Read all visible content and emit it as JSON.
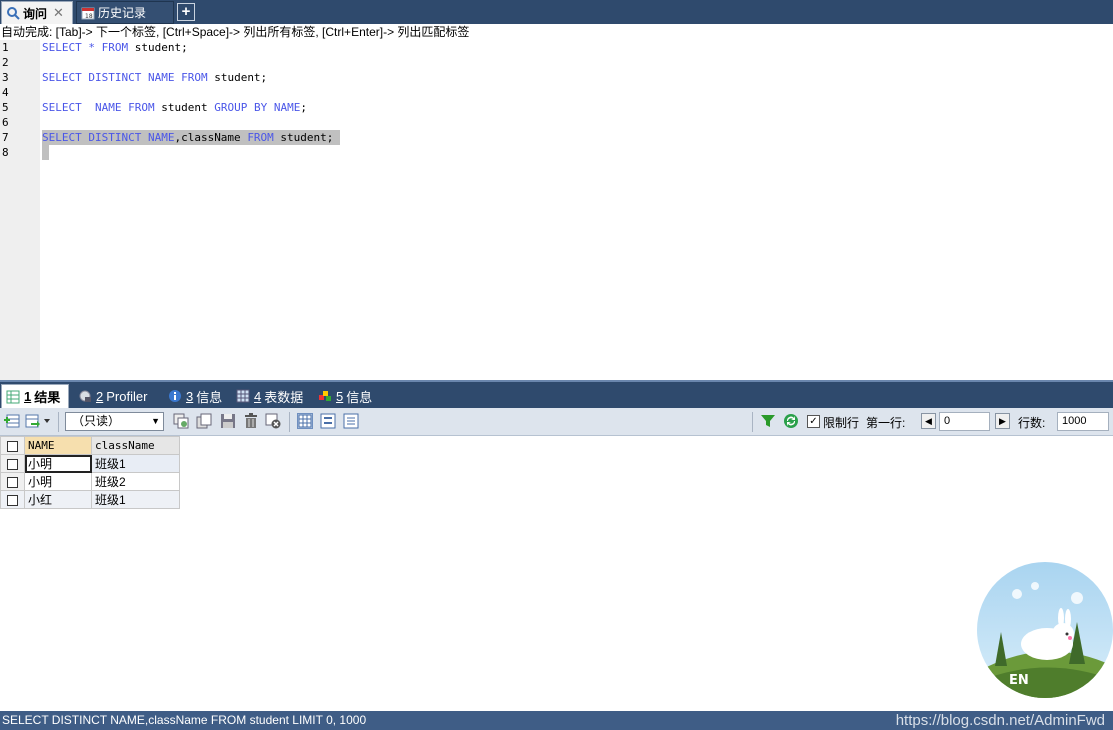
{
  "top_tabs": [
    {
      "label": "询问",
      "close": "✕"
    },
    {
      "label": "历史记录"
    }
  ],
  "add_tab": "+",
  "autocomplete_hint": "自动完成: [Tab]-> 下一个标签, [Ctrl+Space]-> 列出所有标签, [Ctrl+Enter]-> 列出匹配标签",
  "editor": {
    "line_numbers": [
      "1",
      "2",
      "3",
      "4",
      "5",
      "6",
      "7",
      "8"
    ],
    "lines": [
      {
        "kw1": "SELECT",
        "mid": " * ",
        "kw2": "FROM",
        "rest": " student;"
      },
      {
        "kw1": "SELECT DISTINCT NAME",
        "mid": " ",
        "kw2": "FROM",
        "rest": " student;"
      },
      {
        "kw1": "SELECT  NAME",
        "mid": " ",
        "kw2": "FROM",
        "rest": " student ",
        "kw3": "GROUP BY NAME",
        "tail": ";"
      },
      {
        "kw1": "SELECT DISTINCT NAME",
        "mid": ",className ",
        "kw2": "FROM",
        "rest": " student;"
      }
    ]
  },
  "bottom_tabs": [
    {
      "num": "1",
      "label": "结果"
    },
    {
      "num": "2",
      "label": "Profiler"
    },
    {
      "num": "3",
      "label": "信息"
    },
    {
      "num": "4",
      "label": "表数据"
    },
    {
      "num": "5",
      "label": "信息"
    }
  ],
  "toolbar": {
    "readonly_select": "（只读）",
    "limit_rows_label": "限制行",
    "limit_rows_checked": "✓",
    "first_row_label": "第一行:",
    "first_row_value": "0",
    "rows_label": "行数:",
    "rows_value": "1000",
    "prev": "◀",
    "next": "▶"
  },
  "results": {
    "columns": [
      "NAME",
      "className"
    ],
    "rows": [
      [
        "小明",
        "班级1"
      ],
      [
        "小明",
        "班级2"
      ],
      [
        "小红",
        "班级1"
      ]
    ]
  },
  "status_text": "SELECT DISTINCT NAME,className FROM student LIMIT 0, 1000",
  "watermark": "https://blog.csdn.net/AdminFwd",
  "avatar_text": "EN",
  "colors": {
    "keyword": "#4a56e8",
    "tabbar": "#2f4a6d",
    "status": "#3f5d86"
  }
}
